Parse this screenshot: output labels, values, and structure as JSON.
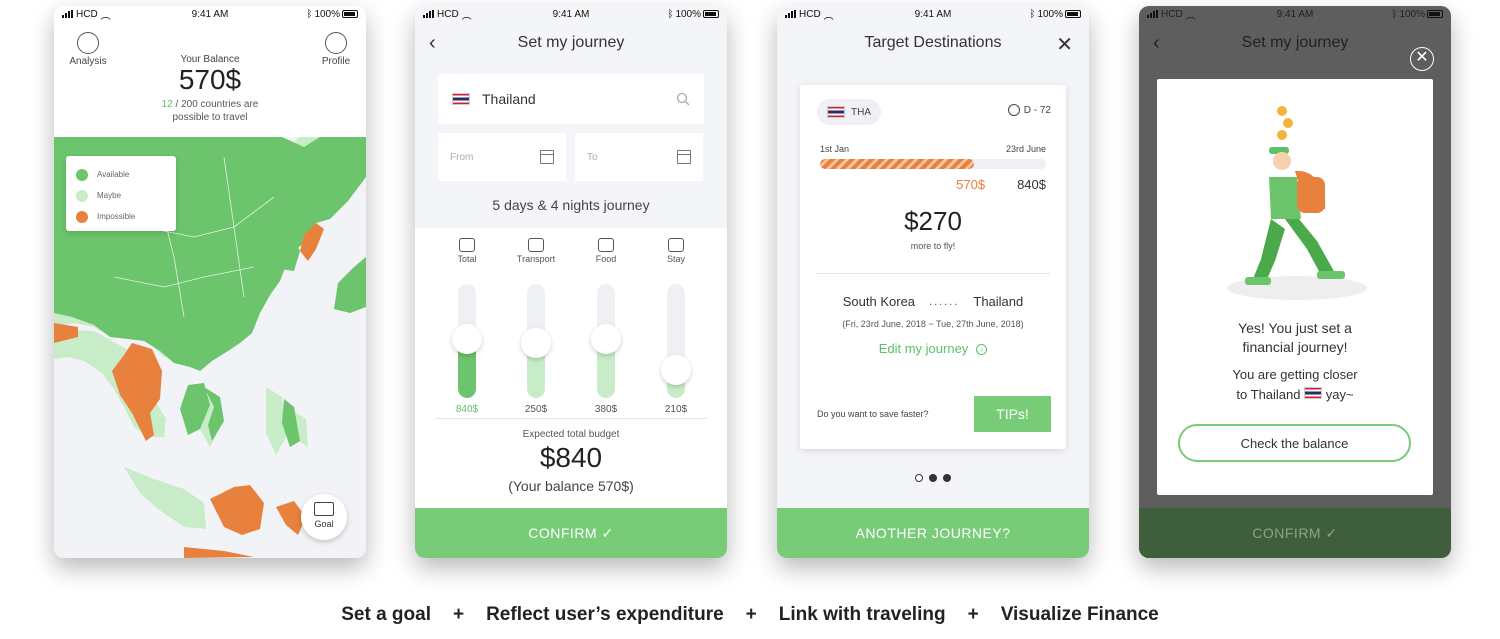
{
  "status_bar": {
    "carrier": "HCD",
    "time": "9:41 AM",
    "battery": "100%"
  },
  "screen1": {
    "nav_left": "Analysis",
    "nav_right": "Profile",
    "balance_label": "Your Balance",
    "balance_value": "570$",
    "countries_count": "12",
    "countries_rest": " / 200 countries are",
    "countries_line2": "possible to travel",
    "legend": [
      {
        "label": "Available",
        "color": "#6cc46c"
      },
      {
        "label": "Maybe",
        "color": "#c8ecc8"
      },
      {
        "label": "Impossible",
        "color": "#e8813e"
      }
    ],
    "goal_label": "Goal"
  },
  "screen2": {
    "title": "Set my journey",
    "destination": "Thailand",
    "from_placeholder": "From",
    "to_placeholder": "To",
    "duration": "5 days & 4 nights journey",
    "categories": [
      {
        "label": "Total",
        "amount": "840$",
        "level": 0.52,
        "highlight": true
      },
      {
        "label": "Transport",
        "amount": "250$",
        "level": 0.48,
        "highlight": false
      },
      {
        "label": "Food",
        "amount": "380$",
        "level": 0.52,
        "highlight": false
      },
      {
        "label": "Stay",
        "amount": "210$",
        "level": 0.25,
        "highlight": false
      }
    ],
    "expected_label": "Expected total budget",
    "expected_value": "$840",
    "balance_note": "(Your balance 570$)",
    "confirm": "CONFIRM ✓"
  },
  "screen3": {
    "title": "Target Destinations",
    "country_code": "THA",
    "dday": "D - 72",
    "start_date": "1st Jan",
    "end_date": "23rd June",
    "progress": 0.68,
    "current_amount": "570$",
    "target_amount": "840$",
    "remaining": "$270",
    "remaining_label": "more to fly!",
    "from_country": "South Korea",
    "dots": "......",
    "to_country": "Thailand",
    "trip_dates": "(Fri, 23rd June, 2018 ~ Tue, 27th June, 2018)",
    "edit_label": "Edit my journey",
    "save_question": "Do you want to save faster?",
    "tips_label": "TIPs!",
    "another": "ANOTHER JOURNEY?"
  },
  "screen4": {
    "title": "Set my journey",
    "msg_line1": "Yes! You just set a",
    "msg_line2": "financial journey!",
    "msg_line3": "You are getting closer",
    "msg_line4_pre": "to Thailand",
    "msg_line4_post": "yay~",
    "check_balance": "Check the balance",
    "confirm": "CONFIRM ✓"
  },
  "footer": [
    "Set a goal",
    "Reflect user’s expenditure",
    "Link with traveling",
    "Visualize Finance"
  ],
  "colors": {
    "green": "#78cc78",
    "light_green": "#c8ecc8",
    "orange": "#e8813e"
  },
  "icons": [
    "signal-icon",
    "wifi-icon",
    "bluetooth-icon",
    "battery-icon",
    "analysis-icon",
    "profile-icon",
    "goal-icon",
    "back-icon",
    "search-icon",
    "calendar-icon",
    "piggy-bank-icon",
    "airplane-icon",
    "food-icon",
    "house-icon",
    "close-icon",
    "clock-icon",
    "chevron-right-icon",
    "flag-thailand-icon",
    "coin-icon"
  ]
}
